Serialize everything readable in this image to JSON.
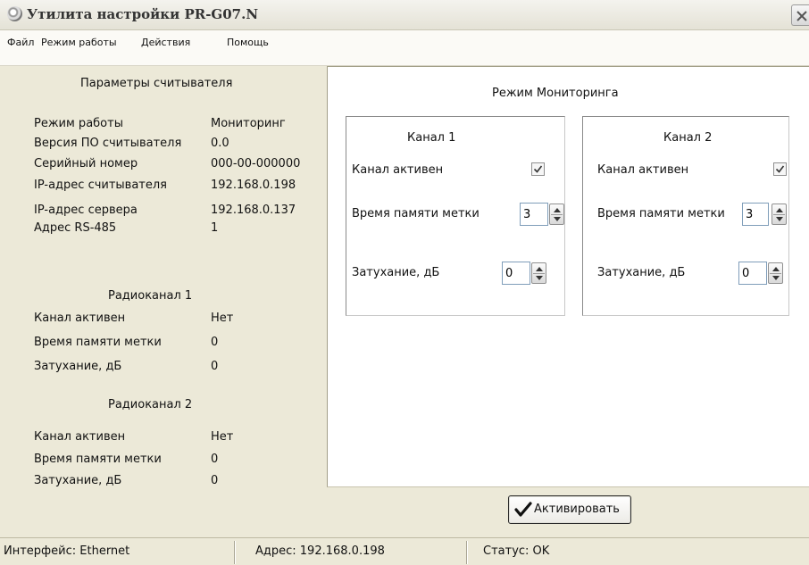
{
  "window": {
    "title": "Утилита настройки PR-G07.N"
  },
  "menu": [
    "Файл",
    "Режим работы",
    "Действия",
    "Помощь"
  ],
  "reader_params": {
    "heading": "Параметры считывателя",
    "rows": [
      {
        "label": "Режим работы",
        "value": "Мониторинг"
      },
      {
        "label": "Версия ПО считывателя",
        "value": "0.0"
      },
      {
        "label": "Серийный номер",
        "value": "000-00-000000"
      },
      {
        "label": "IP-адрес считывателя",
        "value": "192.168.0.198"
      },
      {
        "label": "IP-адрес сервера",
        "value": "192.168.0.137"
      },
      {
        "label": "Адрес RS-485",
        "value": "1"
      }
    ]
  },
  "radio1": {
    "heading": "Радиоканал 1",
    "rows": [
      {
        "label": "Канал активен",
        "value": "Нет"
      },
      {
        "label": "Время памяти метки",
        "value": "0"
      },
      {
        "label": "Затухание, дБ",
        "value": "0"
      }
    ]
  },
  "radio2": {
    "heading": "Радиоканал 2",
    "rows": [
      {
        "label": "Канал активен",
        "value": "Нет"
      },
      {
        "label": "Время памяти метки",
        "value": "0"
      },
      {
        "label": "Затухание, дБ",
        "value": "0"
      }
    ]
  },
  "monitor": {
    "title": "Режим Мониторинга",
    "channels": [
      {
        "title": "Канал 1",
        "active_label": "Канал активен",
        "active": true,
        "memory_label": "Время памяти метки",
        "memory_value": "3",
        "atten_label": "Затухание, дБ",
        "atten_value": "0"
      },
      {
        "title": "Канал 2",
        "active_label": "Канал активен",
        "active": true,
        "memory_label": "Время памяти метки",
        "memory_value": "3",
        "atten_label": "Затухание, дБ",
        "atten_value": "0"
      }
    ],
    "activate_label": "Активировать"
  },
  "status": {
    "interface": "Интерфейс: Ethernet",
    "address": "Адрес: 192.168.0.198",
    "state": "Статус: OK"
  },
  "icons": {
    "app": "app-icon",
    "close": "close-icon",
    "checkbox_check": "checkmark-icon",
    "activate": "checkmark-icon"
  }
}
